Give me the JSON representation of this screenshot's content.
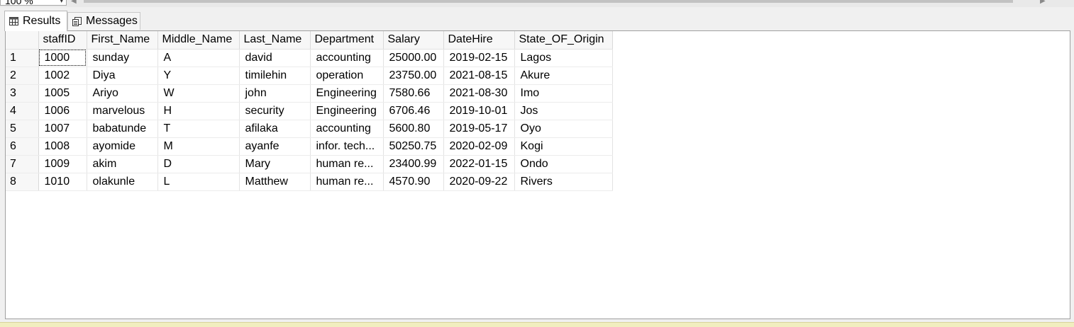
{
  "toolbar": {
    "zoom_value": "100 %",
    "zoom_arrow": "▾",
    "scroll_left_glyph": "◀",
    "scroll_right_glyph": "▶"
  },
  "tabs": [
    {
      "label": "Results",
      "icon": "grid-icon",
      "active": true
    },
    {
      "label": "Messages",
      "icon": "messages-icon",
      "active": false
    }
  ],
  "grid": {
    "columns": [
      "staffID",
      "First_Name",
      "Middle_Name",
      "Last_Name",
      "Department",
      "Salary",
      "DateHire",
      "State_OF_Origin"
    ],
    "rows": [
      {
        "num": "1",
        "cells": [
          "1000",
          "sunday",
          "A",
          "david",
          "accounting",
          "25000.00",
          "2019-02-15",
          "Lagos"
        ]
      },
      {
        "num": "2",
        "cells": [
          "1002",
          "Diya",
          "Y",
          "timilehin",
          "operation",
          "23750.00",
          "2021-08-15",
          "Akure"
        ]
      },
      {
        "num": "3",
        "cells": [
          "1005",
          "Ariyo",
          "W",
          "john",
          "Engineering",
          "7580.66",
          "2021-08-30",
          "Imo"
        ]
      },
      {
        "num": "4",
        "cells": [
          "1006",
          "marvelous",
          "H",
          "security",
          "Engineering",
          "6706.46",
          "2019-10-01",
          "Jos"
        ]
      },
      {
        "num": "5",
        "cells": [
          "1007",
          "babatunde",
          "T",
          "afilaka",
          "accounting",
          "5600.80",
          "2019-05-17",
          "Oyo"
        ]
      },
      {
        "num": "6",
        "cells": [
          "1008",
          "ayomide",
          "M",
          "ayanfe",
          "infor. tech...",
          "50250.75",
          "2020-02-09",
          "Kogi"
        ]
      },
      {
        "num": "7",
        "cells": [
          "1009",
          "akim",
          "D",
          "Mary",
          "human re...",
          "23400.99",
          "2022-01-15",
          "Ondo"
        ]
      },
      {
        "num": "8",
        "cells": [
          "1010",
          "olakunle",
          "L",
          "Matthew",
          "human re...",
          "4570.90",
          "2020-09-22",
          "Rivers"
        ]
      }
    ]
  },
  "colors": {
    "panel_bg": "#ffffff",
    "header_bg": "#f7f7f7",
    "status_strip": "#f1eebf"
  }
}
